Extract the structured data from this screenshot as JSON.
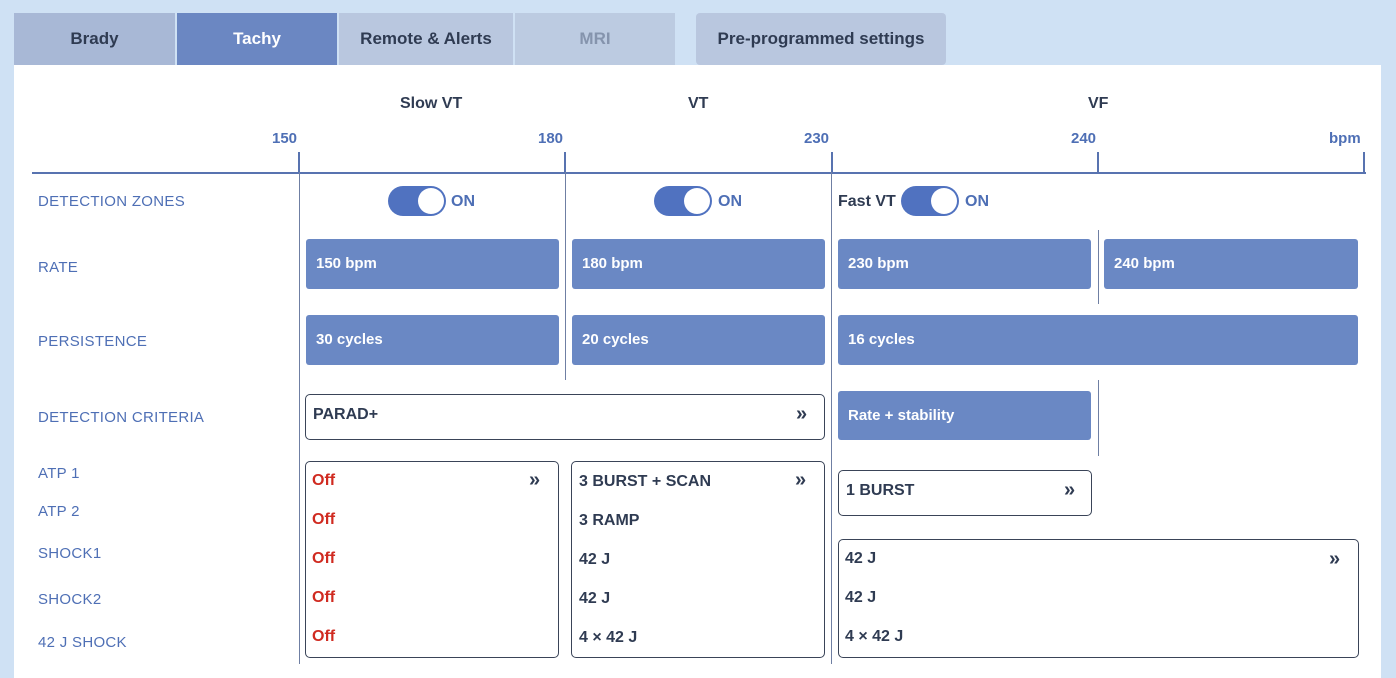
{
  "tabs": {
    "brady": "Brady",
    "tachy": "Tachy",
    "remote": "Remote & Alerts",
    "mri": "MRI",
    "preset": "Pre-programmed settings"
  },
  "zones": {
    "slow_vt": "Slow VT",
    "vt": "VT",
    "vf": "VF"
  },
  "ticks": {
    "t150": "150",
    "t180": "180",
    "t230": "230",
    "t240": "240",
    "unit": "bpm"
  },
  "rows": {
    "detection_zones": "DETECTION ZONES",
    "rate": "RATE",
    "persistence": "PERSISTENCE",
    "detection_criteria": "DETECTION CRITERIA",
    "atp1": "ATP 1",
    "atp2": "ATP 2",
    "shock1": "SHOCK1",
    "shock2": "SHOCK2",
    "shock42": "42 J SHOCK"
  },
  "toggles": {
    "slow_vt": "ON",
    "vt": "ON",
    "fast_vt_label": "Fast VT",
    "fast_vt": "ON"
  },
  "rate": {
    "slow_vt": "150  bpm",
    "vt": "180  bpm",
    "fast_vt": "230  bpm",
    "vf": "240  bpm"
  },
  "persistence": {
    "slow_vt": "30  cycles",
    "vt": "20  cycles",
    "vf": "16  cycles"
  },
  "criteria": {
    "slow_vt_vt": "PARAD+",
    "fast_vt": "Rate + stability"
  },
  "therapy": {
    "slow_vt": [
      "Off",
      "Off",
      "Off",
      "Off",
      "Off"
    ],
    "vt": [
      "3 BURST + SCAN",
      "3 RAMP",
      "42 J",
      "42 J",
      "4 × 42 J"
    ],
    "fast_vt_atp": "1 BURST",
    "vf": [
      "42 J",
      "42 J",
      "4 × 42 J"
    ]
  },
  "colors": {
    "accent": "#6a88c4",
    "off": "#d02a20"
  }
}
